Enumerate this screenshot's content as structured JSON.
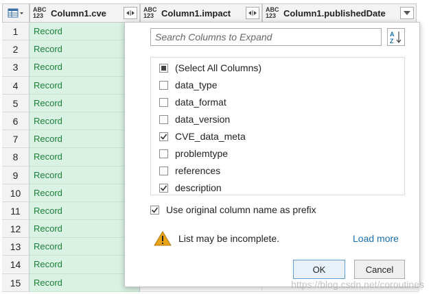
{
  "grid": {
    "columns": [
      {
        "type_top": "ABC",
        "type_bottom": "123",
        "name": "Column1.cve",
        "button": "expand"
      },
      {
        "type_top": "ABC",
        "type_bottom": "123",
        "name": "Column1.impact",
        "button": "expand"
      },
      {
        "type_top": "ABC",
        "type_bottom": "123",
        "name": "Column1.publishedDate",
        "button": "dropdown"
      }
    ],
    "rows": [
      {
        "num": "1",
        "value": "Record"
      },
      {
        "num": "2",
        "value": "Record"
      },
      {
        "num": "3",
        "value": "Record"
      },
      {
        "num": "4",
        "value": "Record"
      },
      {
        "num": "5",
        "value": "Record"
      },
      {
        "num": "6",
        "value": "Record"
      },
      {
        "num": "7",
        "value": "Record"
      },
      {
        "num": "8",
        "value": "Record"
      },
      {
        "num": "9",
        "value": "Record"
      },
      {
        "num": "10",
        "value": "Record"
      },
      {
        "num": "11",
        "value": "Record"
      },
      {
        "num": "12",
        "value": "Record"
      },
      {
        "num": "13",
        "value": "Record"
      },
      {
        "num": "14",
        "value": "Record"
      },
      {
        "num": "15",
        "value": "Record"
      }
    ]
  },
  "popup": {
    "search_placeholder": "Search Columns to Expand",
    "items": [
      {
        "label": "(Select All Columns)",
        "state": "partial"
      },
      {
        "label": "data_type",
        "state": "unchecked"
      },
      {
        "label": "data_format",
        "state": "unchecked"
      },
      {
        "label": "data_version",
        "state": "unchecked"
      },
      {
        "label": "CVE_data_meta",
        "state": "checked"
      },
      {
        "label": "problemtype",
        "state": "unchecked"
      },
      {
        "label": "references",
        "state": "unchecked"
      },
      {
        "label": "description",
        "state": "checked"
      }
    ],
    "prefix_label": "Use original column name as prefix",
    "prefix_checked": true,
    "warning_text": "List may be incomplete.",
    "load_more": "Load more",
    "ok_label": "OK",
    "cancel_label": "Cancel"
  },
  "watermark": "https://blog.csdn.net/coroutines",
  "colors": {
    "record_bg": "#d9f2e3",
    "record_text": "#1a7f37",
    "link": "#1a6fb0",
    "warning": "#e8a317"
  }
}
